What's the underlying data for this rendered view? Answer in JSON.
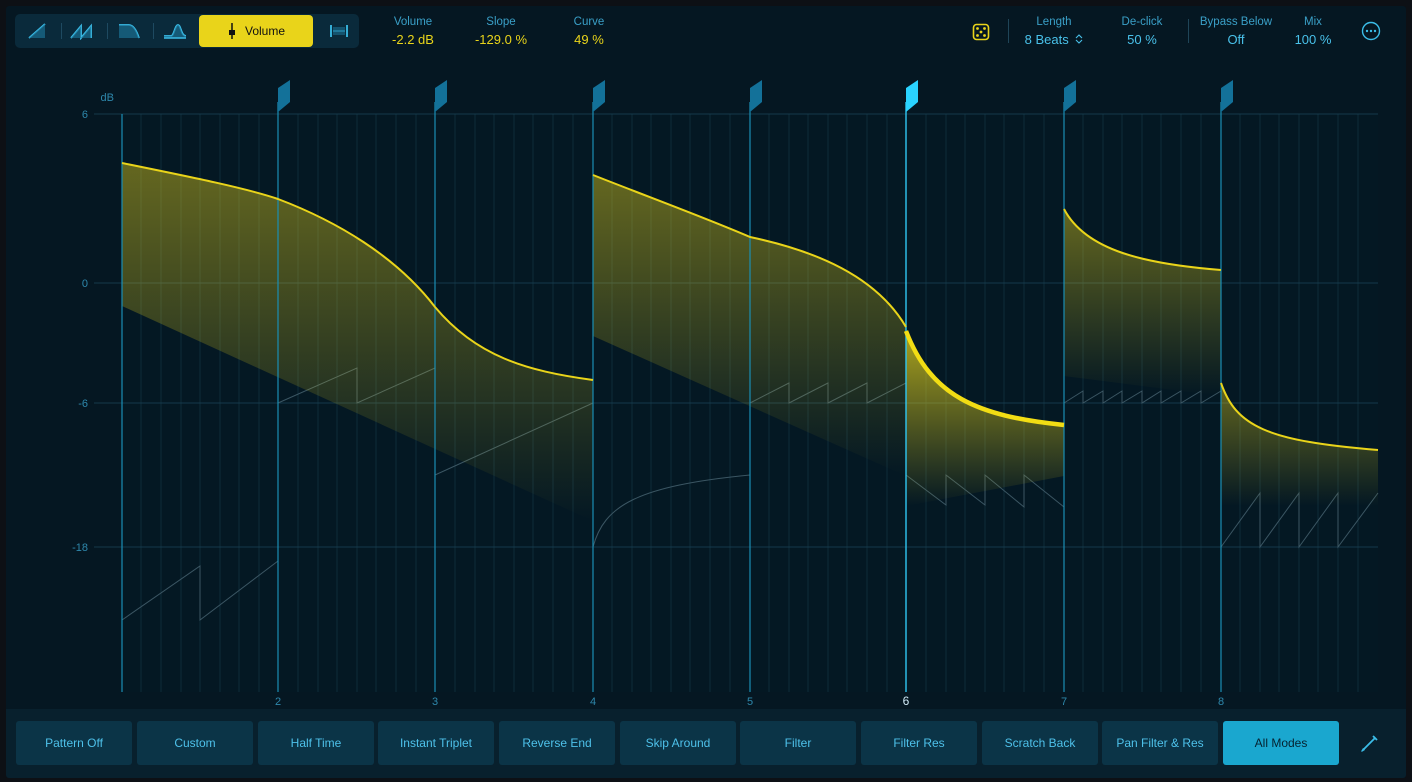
{
  "toolbar": {
    "modes": [
      "ramp-up-icon",
      "double-ramp-icon",
      "ramp-down-icon",
      "pulse-icon"
    ],
    "volume_label": "Volume",
    "stretch_icon": "stretch-icon"
  },
  "params": {
    "volume": {
      "label": "Volume",
      "value": "-2.2 dB"
    },
    "slope": {
      "label": "Slope",
      "value": "-129.0 %"
    },
    "curve": {
      "label": "Curve",
      "value": "49 %"
    },
    "length": {
      "label": "Length",
      "value": "8 Beats"
    },
    "declick": {
      "label": "De-click",
      "value": "50 %"
    },
    "bypass": {
      "label": "Bypass Below",
      "value": "Off"
    },
    "mix": {
      "label": "Mix",
      "value": "100 %"
    }
  },
  "graph": {
    "unit_label": "dB",
    "y_ticks": [
      "6",
      "0",
      "-6",
      "-18"
    ],
    "x_ticks": [
      "2",
      "3",
      "4",
      "5",
      "6",
      "7",
      "8"
    ],
    "selected_beat": "6"
  },
  "presets": [
    {
      "label": "Pattern Off"
    },
    {
      "label": "Custom"
    },
    {
      "label": "Half Time"
    },
    {
      "label": "Instant Triplet"
    },
    {
      "label": "Reverse End"
    },
    {
      "label": "Skip Around"
    },
    {
      "label": "Filter"
    },
    {
      "label": "Filter Res"
    },
    {
      "label": "Scratch Back"
    },
    {
      "label": "Pan Filter & Res"
    },
    {
      "label": "All Modes",
      "active": true
    }
  ],
  "colors": {
    "accent": "#e9d41a",
    "cyan": "#1aa7cf",
    "background": "#051722"
  }
}
